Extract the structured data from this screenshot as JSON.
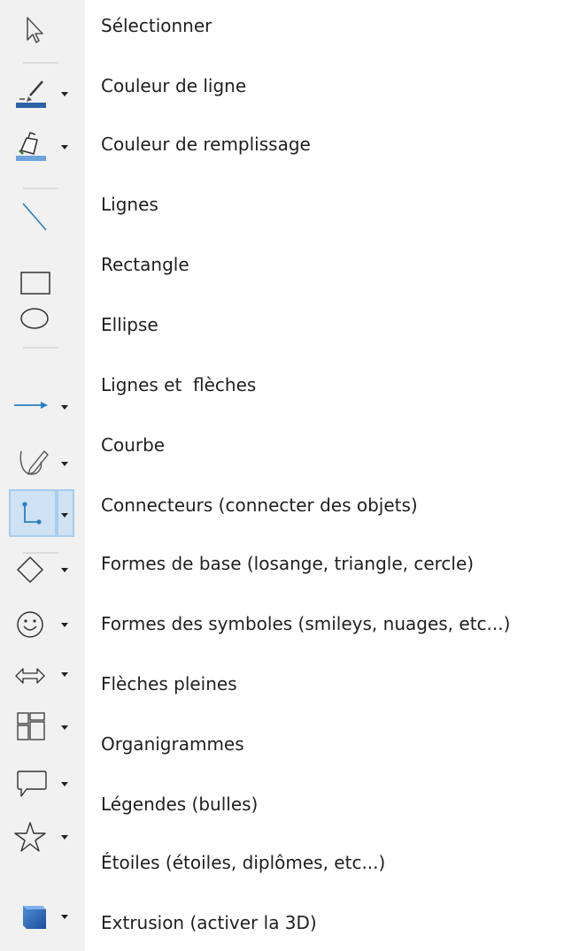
{
  "colors": {
    "toolbar_bg": "#f1f1f1",
    "selected_bg": "#cfe2f4",
    "selected_border": "#a8cdee",
    "accent_blue": "#2a7fc4",
    "line_color_swatch": "#2e62a8",
    "fill_color_swatch": "#6fa3de"
  },
  "tools": [
    {
      "icon": "cursor-arrow-icon",
      "label": "Sélectionner"
    },
    {
      "icon": "line-color-icon",
      "label": "Couleur de ligne"
    },
    {
      "icon": "fill-color-icon",
      "label": "Couleur de remplissage"
    },
    {
      "icon": "line-icon",
      "label": "Lignes"
    },
    {
      "icon": "rectangle-icon",
      "label": "Rectangle"
    },
    {
      "icon": "ellipse-icon",
      "label": "Ellipse"
    },
    {
      "icon": "arrow-line-icon",
      "label": "Lignes et  flèches"
    },
    {
      "icon": "curve-icon",
      "label": "Courbe"
    },
    {
      "icon": "connector-icon",
      "label": "Connecteurs (connecter des objets)",
      "selected": true
    },
    {
      "icon": "diamond-icon",
      "label": "Formes de base (losange, triangle, cercle)"
    },
    {
      "icon": "smiley-icon",
      "label": "Formes des symboles (smileys, nuages, etc...)"
    },
    {
      "icon": "double-arrow-icon",
      "label": "Flèches pleines"
    },
    {
      "icon": "flowchart-icon",
      "label": "Organigrammes"
    },
    {
      "icon": "callout-icon",
      "label": "Légendes (bulles)"
    },
    {
      "icon": "star-icon",
      "label": "Étoiles (étoiles, diplômes, etc...)"
    },
    {
      "icon": "extrusion-cube-icon",
      "label": "Extrusion (activer la 3D)"
    }
  ]
}
